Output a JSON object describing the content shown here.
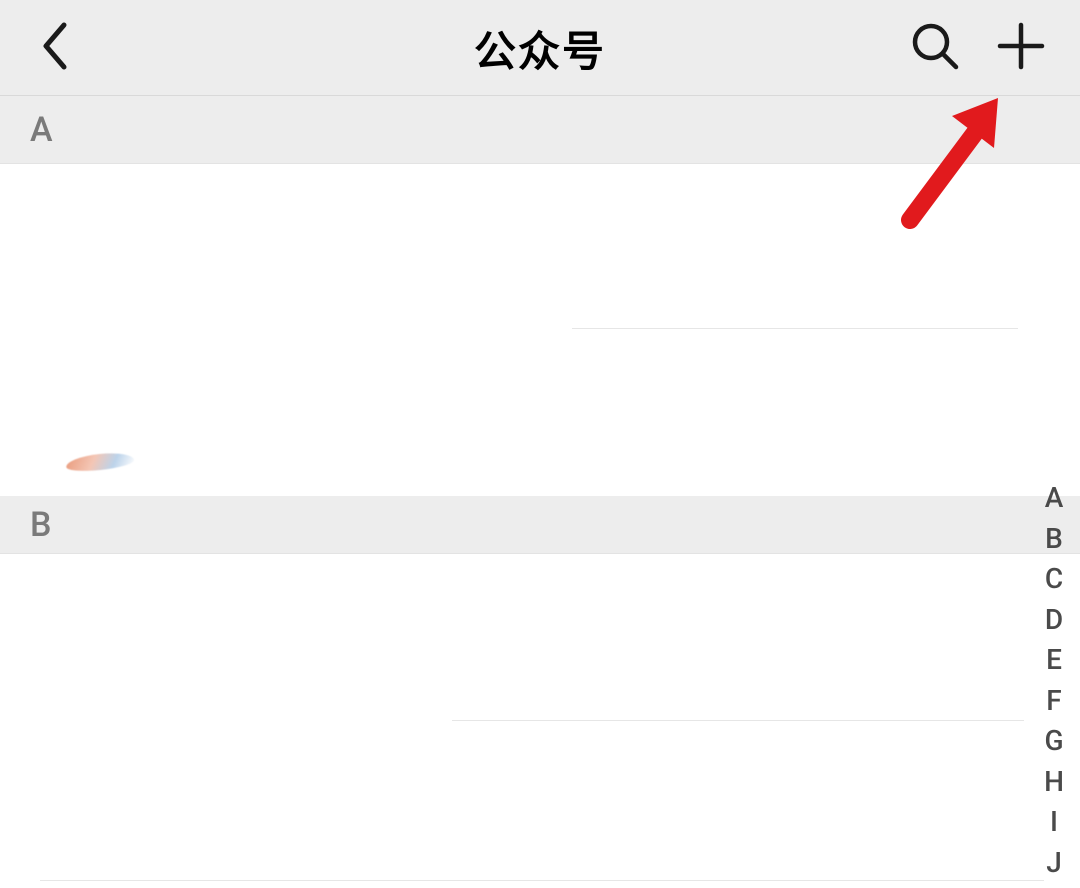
{
  "navbar": {
    "title": "公众号",
    "back_icon": "chevron-left",
    "search_icon": "search",
    "add_icon": "plus"
  },
  "sections": {
    "A": {
      "letter": "A"
    },
    "B": {
      "letter": "B"
    }
  },
  "alpha_index": [
    "A",
    "B",
    "C",
    "D",
    "E",
    "F",
    "G",
    "H",
    "I",
    "J"
  ],
  "annotation": {
    "type": "arrow",
    "color": "#e11a1d",
    "points_to": "add-button"
  }
}
